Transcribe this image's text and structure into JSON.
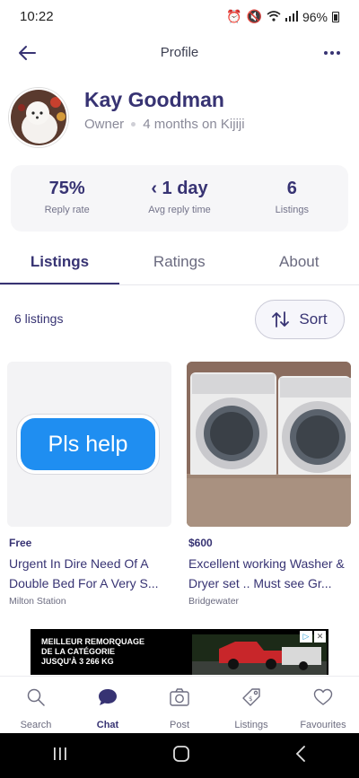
{
  "status_bar": {
    "time": "10:22",
    "battery": "96%"
  },
  "header": {
    "title": "Profile"
  },
  "profile": {
    "name": "Kay Goodman",
    "role": "Owner",
    "tenure": "4 months on Kijiji"
  },
  "stats": [
    {
      "value": "75%",
      "label": "Reply rate"
    },
    {
      "value": "‹ 1 day",
      "label": "Avg reply time"
    },
    {
      "value": "6",
      "label": "Listings"
    }
  ],
  "tabs": [
    {
      "label": "Listings",
      "active": true
    },
    {
      "label": "Ratings",
      "active": false
    },
    {
      "label": "About",
      "active": false
    }
  ],
  "listings_header": {
    "count": "6 listings",
    "sort_label": "Sort"
  },
  "listings": [
    {
      "image_text": "Pls help",
      "price": "Free",
      "title": "Urgent  In Dire Need Of A Double Bed For A Very S...",
      "location": "Milton Station"
    },
    {
      "image_text": "",
      "price": "$600",
      "title": "Excellent working Washer & Dryer set ..  Must see Gr...",
      "location": "Bridgewater"
    }
  ],
  "ad": {
    "text_lines": [
      "MEILLEUR REMORQUAGE",
      "DE LA CATÉGORIE",
      "JUSQU'À 3 266 KG"
    ]
  },
  "bottom_nav": [
    {
      "label": "Search",
      "icon": "search-icon",
      "active": false
    },
    {
      "label": "Chat",
      "icon": "chat-icon",
      "active": true
    },
    {
      "label": "Post",
      "icon": "camera-icon",
      "active": false
    },
    {
      "label": "Listings",
      "icon": "tag-icon",
      "active": false
    },
    {
      "label": "Favourites",
      "icon": "heart-icon",
      "active": false
    }
  ],
  "colors": {
    "primary": "#373373",
    "muted": "#8a8a99",
    "surface": "#f6f6f8",
    "chat_bubble": "#1f8ef1"
  }
}
